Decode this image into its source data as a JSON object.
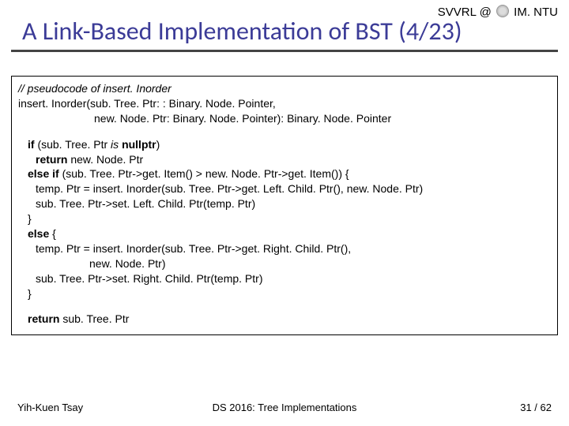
{
  "header": {
    "label_left": "SVVRL @",
    "label_right": "IM. NTU",
    "title": "A Link-Based Implementation of BST (4/23)"
  },
  "code": {
    "c1": "// pseudocode of insert. Inorder",
    "c2": "insert. Inorder(sub. Tree. Ptr: : Binary. Node. Pointer,",
    "c3": "new. Node. Ptr: Binary. Node. Pointer): Binary. Node. Pointer",
    "c4_if": "if",
    "c4_rest": " (sub. Tree. Ptr ",
    "c4_is": "is",
    "c4_tail": " ",
    "c4_null": "nullptr",
    "c4_close": ")",
    "c5_ret": "return",
    "c5_rest": " new. Node. Ptr",
    "c6_elseif": "else if",
    "c6_rest": " (sub. Tree. Ptr->get. Item() > new. Node. Ptr->get. Item()) {",
    "c7": "temp. Ptr = insert. Inorder(sub. Tree. Ptr->get. Left. Child. Ptr(), new. Node. Ptr)",
    "c8": "sub. Tree. Ptr->set. Left. Child. Ptr(temp. Ptr)",
    "c9": "}",
    "c10_else": "else",
    "c10_rest": " {",
    "c11": "temp. Ptr = insert. Inorder(sub. Tree. Ptr->get. Right. Child. Ptr(),",
    "c12": "new. Node. Ptr)",
    "c13": "sub. Tree. Ptr->set. Right. Child. Ptr(temp. Ptr)",
    "c14": "}",
    "c15_ret": "return",
    "c15_rest": " sub. Tree. Ptr"
  },
  "footer": {
    "left": "Yih-Kuen Tsay",
    "center": "DS 2016: Tree Implementations",
    "right": "31 / 62"
  }
}
